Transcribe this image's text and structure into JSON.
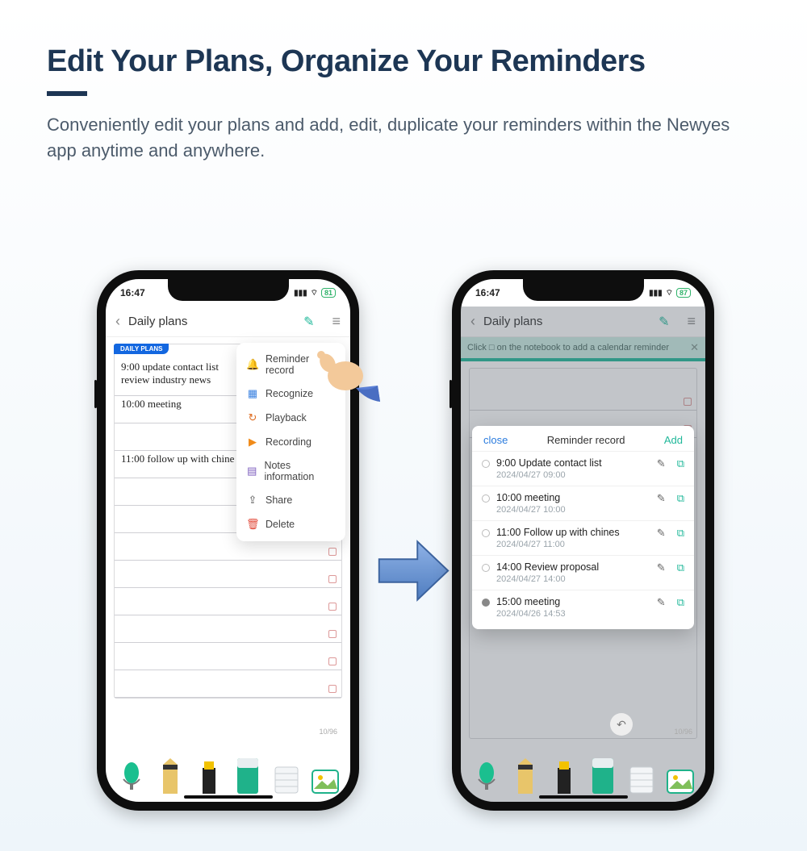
{
  "headline": "Edit Your Plans, Organize Your Reminders",
  "subhead": "Conveniently edit your plans and add, edit, duplicate your reminders within the Newyes app anytime and anywhere.",
  "phone_left": {
    "time": "16:47",
    "battery": "81",
    "nav_title": "Daily plans",
    "tab_label": "DAILY PLANS",
    "notes": [
      "9:00  update contact list",
      "        review industry news",
      "10:00  meeting",
      "",
      "11:00  follow up with chine"
    ],
    "page_indicator": "10/96",
    "menu": [
      {
        "label": "Reminder record",
        "icon": "bell"
      },
      {
        "label": "Recognize",
        "icon": "scan"
      },
      {
        "label": "Playback",
        "icon": "replay"
      },
      {
        "label": "Recording",
        "icon": "record"
      },
      {
        "label": "Notes information",
        "icon": "info"
      },
      {
        "label": "Share",
        "icon": "share"
      },
      {
        "label": "Delete",
        "icon": "trash"
      }
    ]
  },
  "phone_right": {
    "time": "16:47",
    "battery": "87",
    "nav_title": "Daily plans",
    "hint": "Click □ on the notebook to add a calendar reminder",
    "modal": {
      "close": "close",
      "title": "Reminder record",
      "add": "Add",
      "items": [
        {
          "title": "9:00 Update contact list",
          "sub": "2024/04/27  09:00",
          "filled": false
        },
        {
          "title": "10:00 meeting",
          "sub": "2024/04/27  10:00",
          "filled": false
        },
        {
          "title": "11:00 Follow up with chines",
          "sub": "2024/04/27  11:00",
          "filled": false
        },
        {
          "title": "14:00 Review proposal",
          "sub": "2024/04/27  14:00",
          "filled": false
        },
        {
          "title": "15:00 meeting",
          "sub": "2024/04/26  14:53",
          "filled": true
        }
      ]
    },
    "page_indicator": "10/96"
  },
  "icons": {
    "bell": "🔔",
    "scan": "🔍",
    "replay": "↺",
    "record": "▶",
    "info": "📄",
    "share": "↗",
    "trash": "🗑"
  }
}
